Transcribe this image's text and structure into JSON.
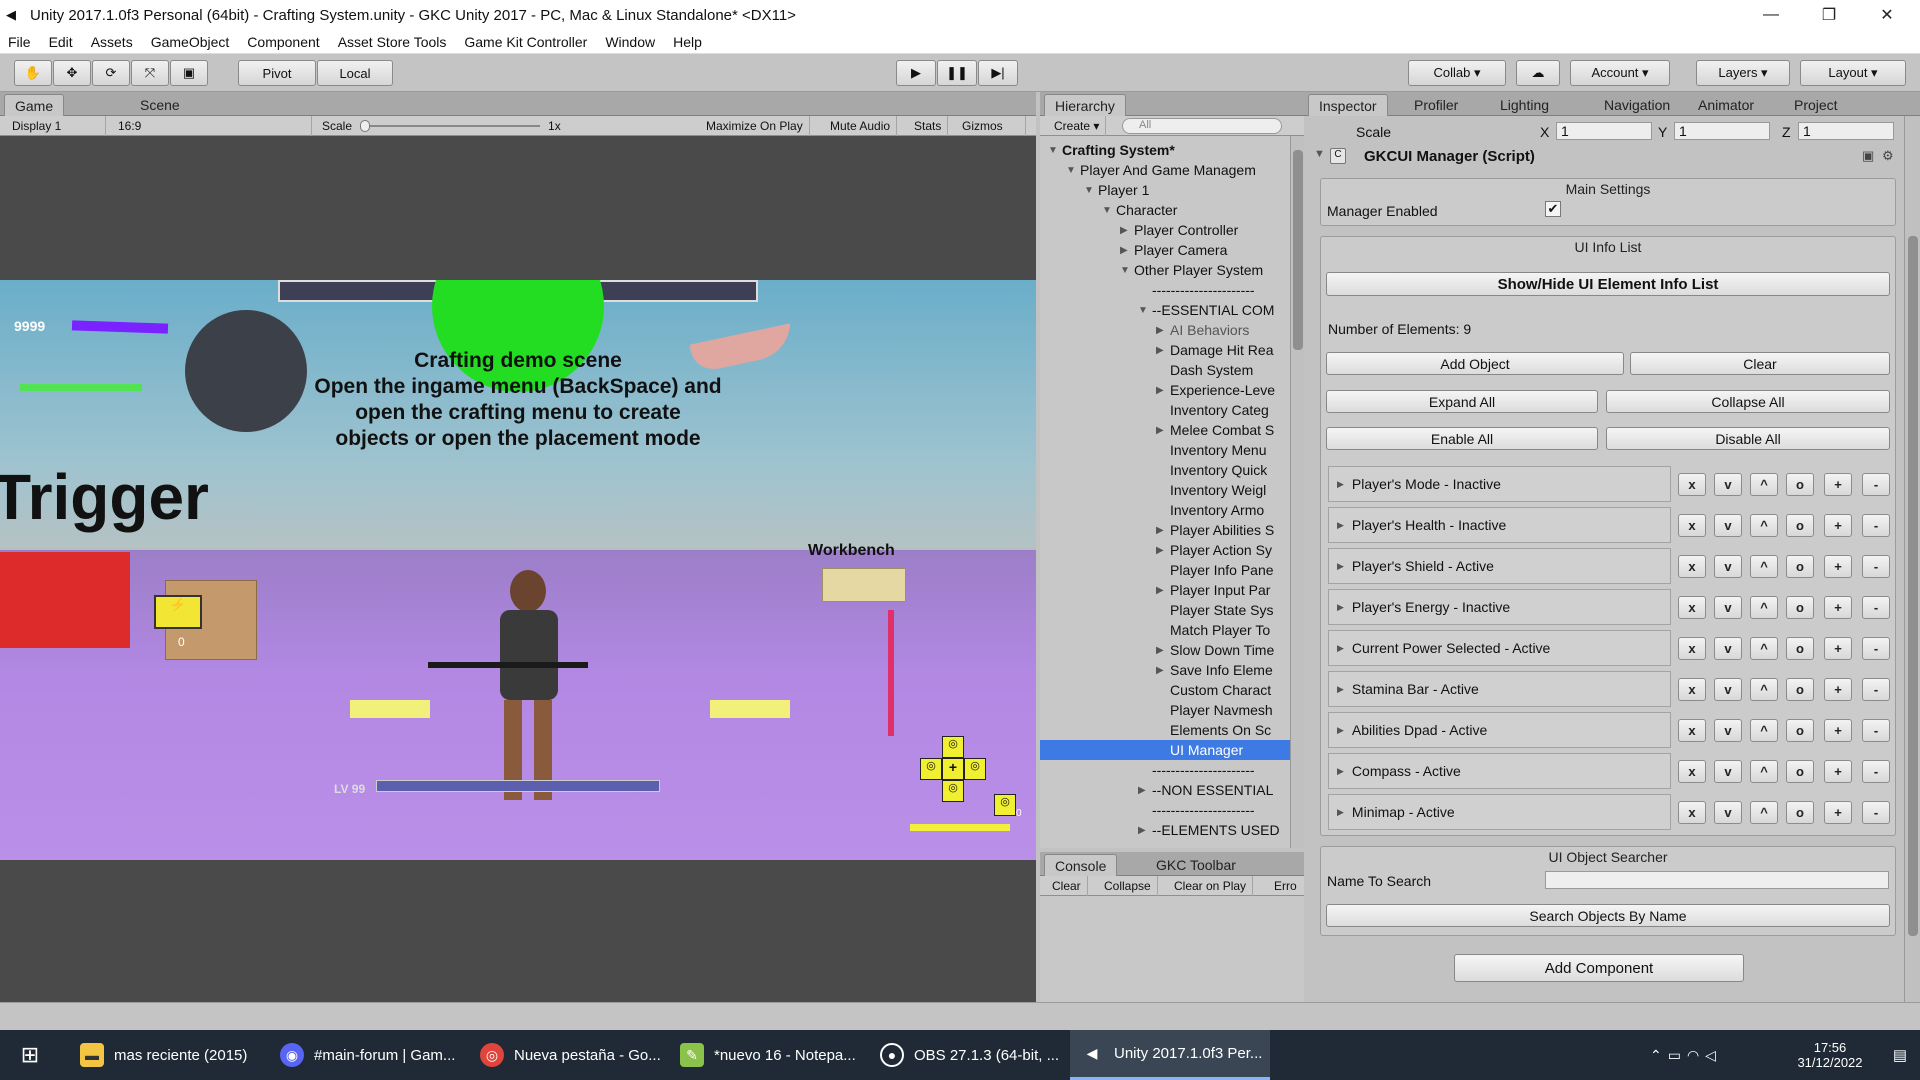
{
  "window": {
    "title": "Unity 2017.1.0f3 Personal (64bit) - Crafting System.unity - GKC Unity 2017 - PC, Mac & Linux Standalone* <DX11>",
    "minimize": "—",
    "maximize": "❐",
    "close": "✕"
  },
  "menu": [
    "File",
    "Edit",
    "Assets",
    "GameObject",
    "Component",
    "Asset Store Tools",
    "Game Kit Controller",
    "Window",
    "Help"
  ],
  "toolbar": {
    "pivot": "Pivot",
    "local": "Local",
    "collab": "Collab ▾",
    "account": "Account ▾",
    "layers": "Layers ▾",
    "layout": "Layout ▾"
  },
  "game": {
    "tab_game": "Game",
    "tab_scene": "Scene",
    "display": "Display 1",
    "aspect": "16:9",
    "scale_label": "Scale",
    "scale_value": "1x",
    "maximize": "Maximize On Play",
    "mute": "Mute Audio",
    "stats": "Stats",
    "gizmos": "Gizmos",
    "hud_health": "9999",
    "scene_title": "Crafting demo scene",
    "scene_line1": "Open the ingame menu (BackSpace) and",
    "scene_line2": "open the crafting menu to create",
    "scene_line3": "objects or open the placement mode",
    "trigger": "Trigger",
    "workbench": "Workbench",
    "level": "LV 99",
    "box_count": "0",
    "icon_count": "0"
  },
  "hierarchy": {
    "tab": "Hierarchy",
    "create": "Create ▾",
    "search": "All",
    "rows": [
      {
        "label": "Crafting System*",
        "indent": 0,
        "arrow": "▼",
        "bold": true
      },
      {
        "label": "Player And Game Managem",
        "indent": 1,
        "arrow": "▼"
      },
      {
        "label": "Player 1",
        "indent": 2,
        "arrow": "▼"
      },
      {
        "label": "Character",
        "indent": 3,
        "arrow": "▼"
      },
      {
        "label": "Player Controller",
        "indent": 4,
        "arrow": "▶"
      },
      {
        "label": "Player Camera",
        "indent": 4,
        "arrow": "▶"
      },
      {
        "label": "Other Player System",
        "indent": 4,
        "arrow": "▼"
      },
      {
        "label": "----------------------",
        "indent": 5,
        "arrow": ""
      },
      {
        "label": "--ESSENTIAL COM",
        "indent": 5,
        "arrow": "▼"
      },
      {
        "label": "AI Behaviors",
        "indent": 6,
        "arrow": "▶",
        "grey": true
      },
      {
        "label": "Damage Hit Rea",
        "indent": 6,
        "arrow": "▶"
      },
      {
        "label": "Dash System",
        "indent": 6,
        "arrow": ""
      },
      {
        "label": "Experience-Leve",
        "indent": 6,
        "arrow": "▶"
      },
      {
        "label": "Inventory Categ",
        "indent": 6,
        "arrow": ""
      },
      {
        "label": "Melee Combat S",
        "indent": 6,
        "arrow": "▶"
      },
      {
        "label": "Inventory Menu",
        "indent": 6,
        "arrow": ""
      },
      {
        "label": "Inventory Quick",
        "indent": 6,
        "arrow": ""
      },
      {
        "label": "Inventory Weigl",
        "indent": 6,
        "arrow": ""
      },
      {
        "label": "Inventory Armo",
        "indent": 6,
        "arrow": ""
      },
      {
        "label": "Player Abilities S",
        "indent": 6,
        "arrow": "▶"
      },
      {
        "label": "Player Action Sy",
        "indent": 6,
        "arrow": "▶"
      },
      {
        "label": "Player Info Pane",
        "indent": 6,
        "arrow": ""
      },
      {
        "label": "Player Input Par",
        "indent": 6,
        "arrow": "▶"
      },
      {
        "label": "Player State Sys",
        "indent": 6,
        "arrow": ""
      },
      {
        "label": "Match Player To",
        "indent": 6,
        "arrow": ""
      },
      {
        "label": "Slow Down Time",
        "indent": 6,
        "arrow": "▶"
      },
      {
        "label": "Save Info Eleme",
        "indent": 6,
        "arrow": "▶"
      },
      {
        "label": "Custom Charact",
        "indent": 6,
        "arrow": ""
      },
      {
        "label": "Player Navmesh",
        "indent": 6,
        "arrow": ""
      },
      {
        "label": "Elements On Sc",
        "indent": 6,
        "arrow": ""
      },
      {
        "label": "UI Manager",
        "indent": 6,
        "arrow": "",
        "selected": true
      },
      {
        "label": "----------------------",
        "indent": 5,
        "arrow": ""
      },
      {
        "label": "--NON ESSENTIAL",
        "indent": 5,
        "arrow": "▶"
      },
      {
        "label": "----------------------",
        "indent": 5,
        "arrow": ""
      },
      {
        "label": "--ELEMENTS USED",
        "indent": 5,
        "arrow": "▶"
      }
    ]
  },
  "console": {
    "tab": "Console",
    "tab2": "GKC Toolbar",
    "clear": "Clear",
    "collapse": "Collapse",
    "clear_on_play": "Clear on Play",
    "error": "Erro"
  },
  "inspector": {
    "tabs": [
      "Inspector",
      "Profiler",
      "Lighting",
      "Navigation",
      "Animator",
      "Project"
    ],
    "scale_label": "Scale",
    "scale_x": "1",
    "scale_y": "1",
    "scale_z": "1",
    "x": "X",
    "y": "Y",
    "z": "Z",
    "component": "GKCUI Manager (Script)",
    "main_settings": "Main Settings",
    "manager_enabled": "Manager Enabled",
    "check": "✔",
    "ui_info_list": "UI Info List",
    "show_hide": "Show/Hide UI Element Info List",
    "num_elements": "Number of Elements: 9",
    "add_object": "Add Object",
    "clear": "Clear",
    "expand_all": "Expand All",
    "collapse_all": "Collapse All",
    "enable_all": "Enable All",
    "disable_all": "Disable All",
    "elements": [
      "Player's Mode - Inactive",
      "Player's Health - Inactive",
      "Player's Shield - Active",
      "Player's Energy - Inactive",
      "Current Power Selected - Active",
      "Stamina Bar - Active",
      "Abilities Dpad - Active",
      "Compass - Active",
      "Minimap - Active"
    ],
    "row_buttons": [
      "x",
      "v",
      "^",
      "o",
      "+",
      "-"
    ],
    "searcher": "UI Object Searcher",
    "name_to_search": "Name To Search",
    "search_btn": "Search Objects By Name",
    "add_component": "Add Component"
  },
  "taskbar": {
    "items": [
      "mas reciente (2015)",
      "#main-forum | Gam...",
      "Nueva pestaña - Go...",
      "*nuevo 16 - Notepa...",
      "OBS 27.1.3 (64-bit, ...",
      "Unity 2017.1.0f3 Per..."
    ],
    "time": "17:56",
    "date": "31/12/2022"
  }
}
